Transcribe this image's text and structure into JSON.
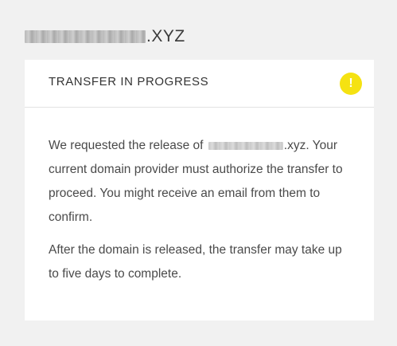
{
  "page": {
    "domain_suffix": ".XYZ"
  },
  "card": {
    "title": "TRANSFER IN PROGRESS",
    "status_icon_glyph": "!",
    "status_icon": "warning-icon",
    "status_color": "#f5e212",
    "paragraph1_before": "We requested the release of",
    "paragraph1_domain_suffix": ".xyz.",
    "paragraph1_after": "Your current domain provider must authorize the transfer to proceed. You might receive an email from them to confirm.",
    "paragraph2": "After the domain is released, the transfer may take up to five days to complete."
  }
}
